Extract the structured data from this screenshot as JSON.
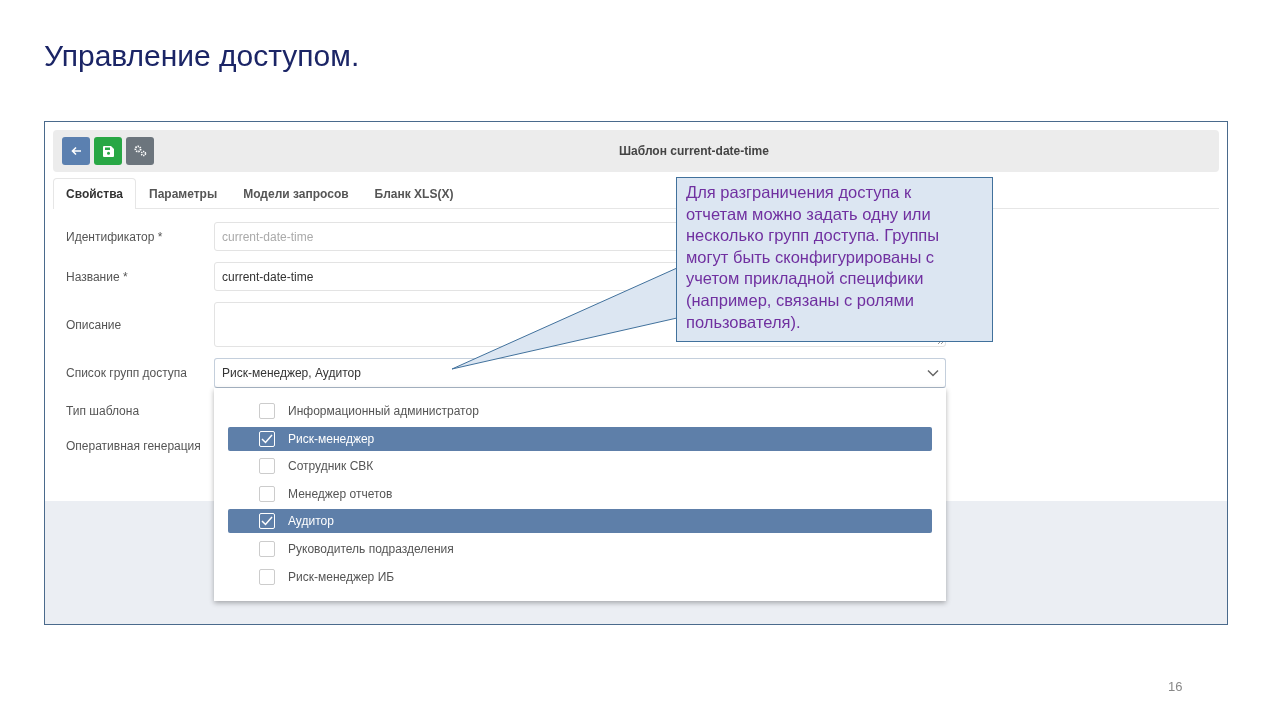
{
  "title": "Управление доступом.",
  "toolbar": {
    "buttons": [
      {
        "kind": "back"
      },
      {
        "kind": "save"
      },
      {
        "kind": "settings"
      }
    ],
    "title": "Шаблон current-date-time"
  },
  "tabs": [
    {
      "label": "Свойства",
      "selected": true
    },
    {
      "label": "Параметры",
      "selected": false
    },
    {
      "label": "Модели запросов",
      "selected": false
    },
    {
      "label": "Бланк XLS(X)",
      "selected": false
    }
  ],
  "fields": [
    {
      "label": "Идентификатор *",
      "kind": "text",
      "value": "current-date-time",
      "disabled": true
    },
    {
      "label": "Название *",
      "kind": "text",
      "value": "current-date-time",
      "disabled": false
    },
    {
      "label": "Описание",
      "kind": "textarea"
    },
    {
      "label": "Список групп доступа",
      "kind": "select",
      "value": "Риск-менеджер, Аудитор",
      "expanded": true
    },
    {
      "label": "Тип шаблона",
      "kind": "covered"
    },
    {
      "label": "Оперативная генерация",
      "kind": "covered"
    }
  ],
  "dropdown": [
    {
      "label": "Информационный администратор",
      "checked": false
    },
    {
      "label": "Риск-менеджер",
      "checked": true
    },
    {
      "label": "Сотрудник СВК",
      "checked": false
    },
    {
      "label": "Менеджер отчетов",
      "checked": false
    },
    {
      "label": "Аудитор",
      "checked": true
    },
    {
      "label": "Руководитель подразделения",
      "checked": false
    },
    {
      "label": "Риск-менеджер ИБ",
      "checked": false
    }
  ],
  "callout": "Для разграничения доступа к отчетам можно задать одну или несколько групп доступа. Группы могут быть сконфигурированы с учетом прикладной специфики (например, связаны с ролями пользователя).",
  "page_number": "16"
}
